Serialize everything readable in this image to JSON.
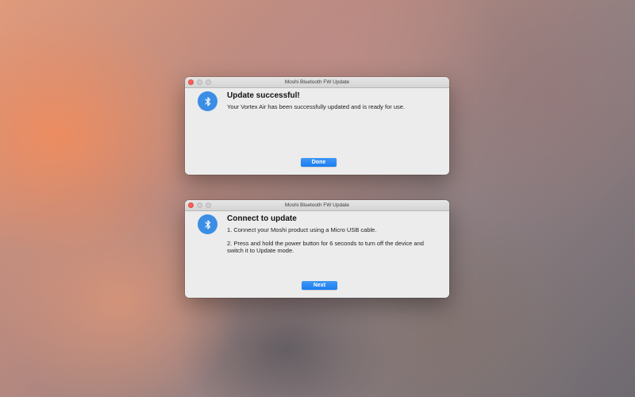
{
  "windows": [
    {
      "title": "Moshi Bluetooth FW Update",
      "heading": "Update successful!",
      "lines": [
        "Your Vortex Air has been successfully updated and is ready for use."
      ],
      "button_label": "Done",
      "icon": "bluetooth-icon"
    },
    {
      "title": "Moshi Bluetooth FW Update",
      "heading": "Connect to update",
      "lines": [
        "1. Connect your Moshi product using a Micro USB cable.",
        "2. Press and hold the power button for 6 seconds to turn off the device and switch it to Update mode."
      ],
      "button_label": "Next",
      "icon": "bluetooth-icon"
    }
  ],
  "colors": {
    "accent": "#1a7ef0",
    "icon_background": "#3c8ee4",
    "close_button": "#fc605c"
  }
}
